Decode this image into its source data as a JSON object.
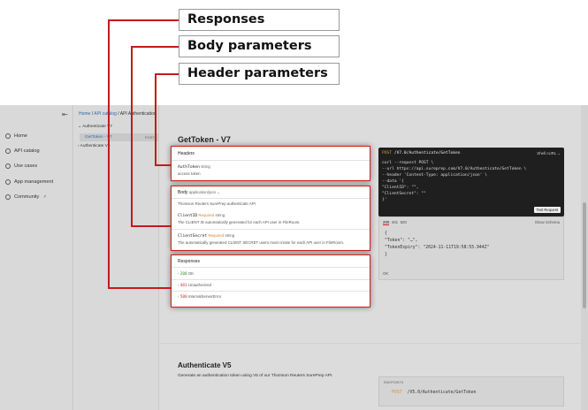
{
  "callouts": {
    "responses": "Responses",
    "body": "Body parameters",
    "header": "Header parameters"
  },
  "sidebar": {
    "items": [
      {
        "label": "Home",
        "icon": "home-icon"
      },
      {
        "label": "API catalog",
        "icon": "catalog-icon"
      },
      {
        "label": "Use cases",
        "icon": "use-cases-icon"
      },
      {
        "label": "App management",
        "icon": "app-icon"
      },
      {
        "label": "Community",
        "icon": "community-icon",
        "external": "↗"
      }
    ],
    "collapse": "⇤"
  },
  "tree": {
    "group1": "⌄  Authenticate V7",
    "selected": "GetToken - V7",
    "selected_method": "POST",
    "group2": "›  Authenticate V5"
  },
  "breadcrumb": {
    "home": "Home",
    "sep1": " / ",
    "catalog": "API catalog",
    "sep2": " / ",
    "current": "API Authentication"
  },
  "main": {
    "title": "GetToken - V7",
    "headers": {
      "title": "Headers",
      "param": "AuthToken",
      "type": "string",
      "desc": "access token"
    },
    "body": {
      "title": "Body",
      "content_type": "application/json ⌄",
      "desc": "Thomson Reuters SurePrep authenticate API",
      "p1_name": "ClientID",
      "p1_req": "Required",
      "p1_type": "string",
      "p1_desc": "The CLIENT ID automatically generated for each API user in FileRoom.",
      "p2_name": "ClientSecret",
      "p2_req": "Required",
      "p2_type": "string",
      "p2_desc": "The automatically generated CLIENT SECRET users must create for each API user in FileRoom."
    },
    "responses": {
      "title": "Responses",
      "r1_code": "200",
      "r1_text": "OK",
      "r2_code": "401",
      "r2_text": "Unauthorized",
      "r3_code": "500",
      "r3_text": "InternalServerError"
    }
  },
  "code": {
    "method": "POST",
    "path": " /V7.0/Authenticate/GetToken",
    "lang": "Shell cURL ⌄",
    "l1": "curl --request POST \\",
    "l2": "  --url https://api.sureprep.com/V7.0/Authenticate/GetToken \\",
    "l3": "  --header 'Content-Type: application/json' \\",
    "l4": "  --data '{",
    "l5": "  \"ClientID\": \"\",",
    "l6": "  \"ClientSecret\": \"\"",
    "l7": "}'",
    "test": "Test Request"
  },
  "response_panel": {
    "tabs": [
      "200",
      "401",
      "500"
    ],
    "schema": "Show Schema",
    "l1": "{",
    "l2": "  \"Token\": \"…\",",
    "l3": "  \"TokenExpiry\": \"2024-11-11T19:58:55.944Z\"",
    "l4": "}",
    "ok": "OK"
  },
  "section2": {
    "title": "Authenticate V5",
    "desc": "Generate an authentication token using V5 of our Thomson Reuters SurePrep API.",
    "endpoints_label": "ENDPOINTS",
    "ep_method": "POST",
    "ep_path": "/V5.0/Authenticate/GetToken"
  }
}
